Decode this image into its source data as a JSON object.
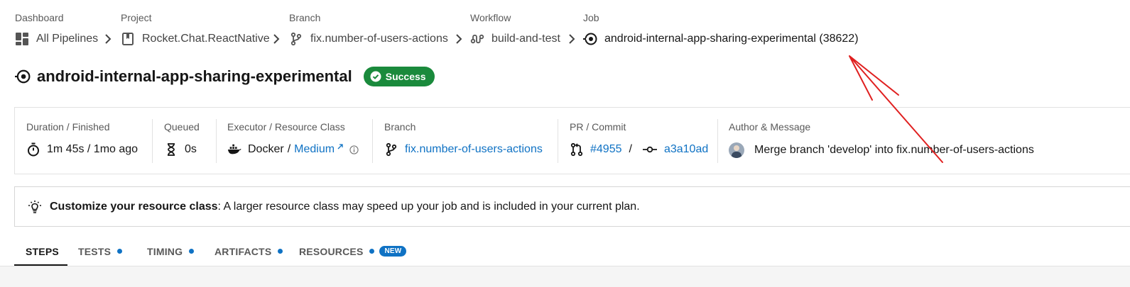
{
  "breadcrumb": {
    "dashboard": {
      "label": "Dashboard",
      "value": "All Pipelines"
    },
    "project": {
      "label": "Project",
      "value": "Rocket.Chat.ReactNative"
    },
    "branch": {
      "label": "Branch",
      "value": "fix.number-of-users-actions"
    },
    "workflow": {
      "label": "Workflow",
      "value": "build-and-test"
    },
    "job": {
      "label": "Job",
      "value": "android-internal-app-sharing-experimental (38622)"
    }
  },
  "header": {
    "title": "android-internal-app-sharing-experimental",
    "status": "Success",
    "status_color": "#1a8a3c"
  },
  "info": {
    "duration": {
      "label": "Duration / Finished",
      "value": "1m 45s / 1mo ago"
    },
    "queued": {
      "label": "Queued",
      "value": "0s"
    },
    "executor": {
      "label": "Executor / Resource Class",
      "executor": "Docker",
      "separator": "/",
      "resource_class": "Medium"
    },
    "branch": {
      "label": "Branch",
      "value": "fix.number-of-users-actions"
    },
    "pr_commit": {
      "label": "PR / Commit",
      "pr": "#4955",
      "separator": "/",
      "commit": "a3a10ad"
    },
    "author": {
      "label": "Author & Message",
      "message": "Merge branch 'develop' into fix.number-of-users-actions"
    }
  },
  "tip": {
    "bold": "Customize your resource class",
    "text": ": A larger resource class may speed up your job and is included in your current plan."
  },
  "tabs": [
    {
      "label": "STEPS",
      "active": true
    },
    {
      "label": "TESTS",
      "dot": true
    },
    {
      "label": "TIMING",
      "dot": true
    },
    {
      "label": "ARTIFACTS",
      "dot": true
    },
    {
      "label": "RESOURCES",
      "dot": true,
      "badge": "NEW"
    }
  ],
  "colors": {
    "accent": "#0f72c4",
    "success": "#1a8a3c",
    "annotation": "#e02020"
  }
}
